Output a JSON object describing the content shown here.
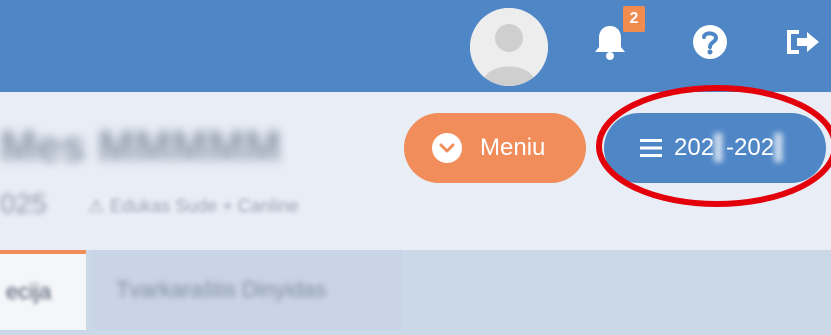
{
  "header": {
    "notifications_count": "2",
    "icons": {
      "avatar": "user-avatar",
      "notifications": "bell-icon",
      "help": "question-icon",
      "logout": "logout-icon"
    },
    "colors": {
      "header_bg": "#4f86c6",
      "badge_bg": "#f28c4e"
    }
  },
  "page": {
    "title_blurred": "Mes MMMMM",
    "year_small_blurred": "025",
    "subtitle_blurred": "Edukas Sude + Canline"
  },
  "actions": {
    "menu_label": "Meniu",
    "year_prefix": "202",
    "year_mid": "-202",
    "colors": {
      "menu_bg": "#f08d5b",
      "year_bg": "#4f86c6",
      "highlight": "#e3000b"
    }
  },
  "tabs": [
    {
      "label": "ecija",
      "active": true
    },
    {
      "label": "Tvarkaraštis Dinyidas",
      "active": false
    }
  ]
}
